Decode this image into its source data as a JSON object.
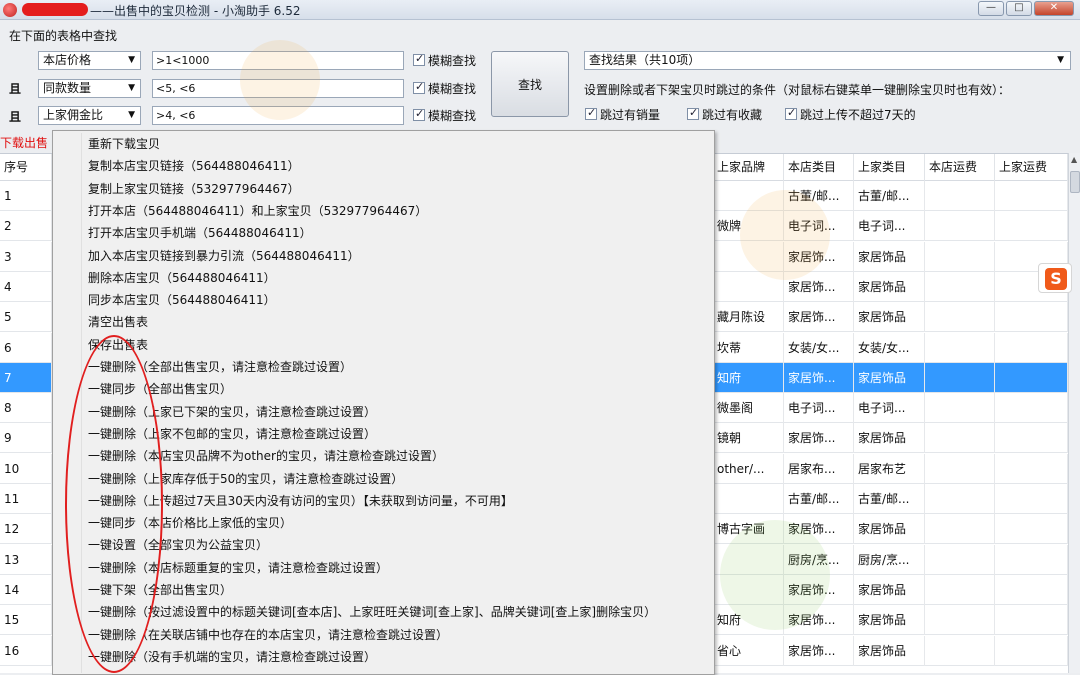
{
  "window": {
    "title": "——出售中的宝贝检测 - 小淘助手 6.52",
    "buttons": {
      "minimize": "—",
      "maximize": "□",
      "close": "✕"
    }
  },
  "search": {
    "section_label": "在下面的表格中查找",
    "rows": [
      {
        "prefix": "",
        "field": "本店价格",
        "value": ">1<1000",
        "fuzzy_label": "模糊查找"
      },
      {
        "prefix": "且",
        "field": "同款数量",
        "value": "<5, <6",
        "fuzzy_label": "模糊查找"
      },
      {
        "prefix": "且",
        "field": "上家佣金比",
        "value": ">4, <6",
        "fuzzy_label": "模糊查找"
      }
    ],
    "find_button": "查找",
    "result_select": "查找结果（共10项）",
    "skip_text": "设置删除或者下架宝贝时跳过的条件（对鼠标右键菜单一键删除宝贝时也有效）：",
    "skip_options": [
      "跳过有销量",
      "跳过有收藏",
      "跳过上传不超过7天的"
    ]
  },
  "download_label": "下载出售",
  "table": {
    "headers": [
      "序号",
      "上家品牌",
      "本店类目",
      "上家类目",
      "本店运费",
      "上家运费"
    ],
    "rows": [
      {
        "no": "1",
        "brand": "",
        "shop_cat": "古董/邮...",
        "src_cat": "古董/邮..."
      },
      {
        "no": "2",
        "brand": "微牌",
        "shop_cat": "电子词...",
        "src_cat": "电子词..."
      },
      {
        "no": "3",
        "brand": "",
        "shop_cat": "家居饰...",
        "src_cat": "家居饰品"
      },
      {
        "no": "4",
        "brand": "",
        "shop_cat": "家居饰...",
        "src_cat": "家居饰品"
      },
      {
        "no": "5",
        "brand": "藏月陈设",
        "shop_cat": "家居饰...",
        "src_cat": "家居饰品"
      },
      {
        "no": "6",
        "brand": "坎蒂",
        "shop_cat": "女装/女...",
        "src_cat": "女装/女..."
      },
      {
        "no": "7",
        "brand": "知府",
        "shop_cat": "家居饰...",
        "src_cat": "家居饰品"
      },
      {
        "no": "8",
        "brand": "微墨阁",
        "shop_cat": "电子词...",
        "src_cat": "电子词..."
      },
      {
        "no": "9",
        "brand": "镜朝",
        "shop_cat": "家居饰...",
        "src_cat": "家居饰品"
      },
      {
        "no": "10",
        "brand": "other/...",
        "shop_cat": "居家布...",
        "src_cat": "居家布艺"
      },
      {
        "no": "11",
        "brand": "",
        "shop_cat": "古董/邮...",
        "src_cat": "古董/邮..."
      },
      {
        "no": "12",
        "brand": "博古字画",
        "shop_cat": "家居饰...",
        "src_cat": "家居饰品"
      },
      {
        "no": "13",
        "brand": "",
        "shop_cat": "厨房/烹...",
        "src_cat": "厨房/烹..."
      },
      {
        "no": "14",
        "brand": "",
        "shop_cat": "家居饰...",
        "src_cat": "家居饰品"
      },
      {
        "no": "15",
        "brand": "知府",
        "shop_cat": "家居饰...",
        "src_cat": "家居饰品"
      },
      {
        "no": "16",
        "brand": "省心",
        "shop_cat": "家居饰...",
        "src_cat": "家居饰品"
      }
    ],
    "selected_row": "7"
  },
  "context_menu": {
    "items": [
      "重新下载宝贝",
      "复制本店宝贝链接（564488046411）",
      "复制上家宝贝链接（532977964467）",
      "打开本店（564488046411）和上家宝贝（532977964467）",
      "打开本店宝贝手机端（564488046411）",
      "加入本店宝贝链接到暴力引流（564488046411）",
      "删除本店宝贝（564488046411）",
      "同步本店宝贝（564488046411）",
      "清空出售表",
      "保存出售表",
      "一键删除（全部出售宝贝，请注意检查跳过设置）",
      "一键同步（全部出售宝贝）",
      "一键删除（上家已下架的宝贝，请注意检查跳过设置）",
      "一键删除（上家不包邮的宝贝，请注意检查跳过设置）",
      "一键删除（本店宝贝品牌不为other的宝贝，请注意检查跳过设置）",
      "一键删除（上家库存低于50的宝贝，请注意检查跳过设置）",
      "一键删除（上传超过7天且30天内没有访问的宝贝）【未获取到访问量，不可用】",
      "一键同步（本店价格比上家低的宝贝）",
      "一键设置（全部宝贝为公益宝贝）",
      "一键删除（本店标题重复的宝贝，请注意检查跳过设置）",
      "一键下架（全部出售宝贝）",
      "一键删除（按过滤设置中的标题关键词[查本店]、上家旺旺关键词[查上家]、品牌关键词[查上家]删除宝贝）",
      "一键删除（在关联店铺中也存在的本店宝贝，请注意检查跳过设置）",
      "一键删除（没有手机端的宝贝，请注意检查跳过设置）"
    ]
  },
  "sidebar_badge": "S",
  "colors": {
    "selection": "#3399ff",
    "annotation": "#e11f1f",
    "warning_text": "#e01010"
  }
}
